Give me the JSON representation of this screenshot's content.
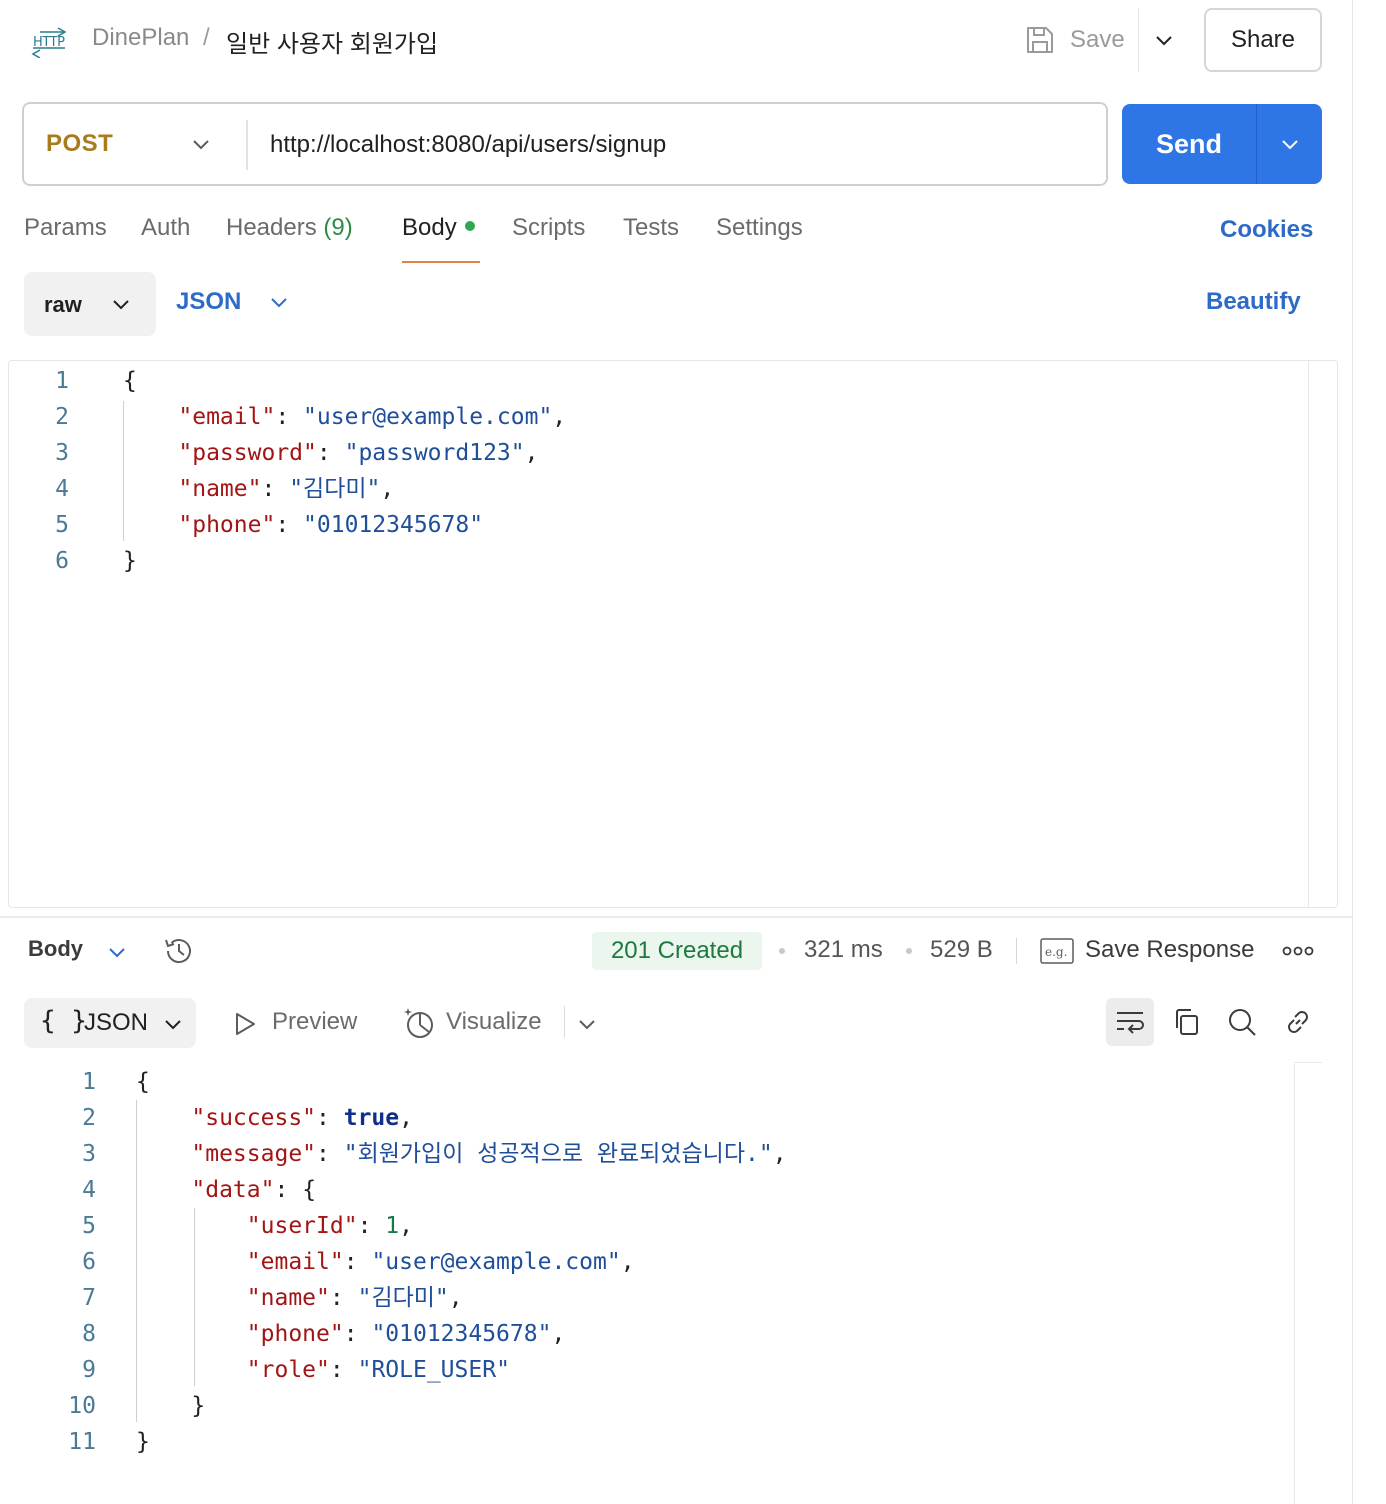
{
  "header": {
    "workspace": "DinePlan",
    "separator": "/",
    "request_name": "일반 사용자 회원가입",
    "save_label": "Save",
    "share_label": "Share"
  },
  "request": {
    "method": "POST",
    "url": "http://localhost:8080/api/users/signup",
    "send_label": "Send"
  },
  "tabs": {
    "params": "Params",
    "auth": "Auth",
    "headers": "Headers",
    "headers_count": "(9)",
    "body": "Body",
    "scripts": "Scripts",
    "tests": "Tests",
    "settings": "Settings",
    "cookies": "Cookies"
  },
  "body_options": {
    "mode": "raw",
    "language": "JSON",
    "beautify": "Beautify"
  },
  "request_body": [
    "{",
    "    \"email\": \"user@example.com\",",
    "    \"password\": \"password123\",",
    "    \"name\": \"김다미\",",
    "    \"phone\": \"01012345678\"",
    "}"
  ],
  "response": {
    "view": "Body",
    "status": "201 Created",
    "time": "321 ms",
    "size": "529 B",
    "save_response": "Save Response",
    "format_braces": "{ }",
    "format": "JSON",
    "preview": "Preview",
    "visualize": "Visualize",
    "body": [
      "{",
      "    \"success\": true,",
      "    \"message\": \"회원가입이 성공적으로 완료되었습니다.\",",
      "    \"data\": {",
      "        \"userId\": 1,",
      "        \"email\": \"user@example.com\",",
      "        \"name\": \"김다미\",",
      "        \"phone\": \"01012345678\",",
      "        \"role\": \"ROLE_USER\"",
      "    }",
      "}"
    ]
  },
  "colors": {
    "method": "#a97b1b",
    "send": "#2e75e6",
    "link": "#2e6ac7",
    "status_ok": "#1d7a3c",
    "tab_active_underline": "#e8804a",
    "json_key": "#a31515",
    "json_string": "#1f4e9a",
    "json_number": "#157a45"
  },
  "icons": {
    "request_type": "http-icon",
    "save": "floppy-disk-icon",
    "history": "history-icon",
    "save_response": "e.g.-example-icon",
    "more": "more-horizontal-icon",
    "preview": "play-icon",
    "visualize": "visualize-icon",
    "wrap": "word-wrap-icon",
    "copy": "copy-icon",
    "search": "search-icon",
    "link": "link-icon"
  }
}
